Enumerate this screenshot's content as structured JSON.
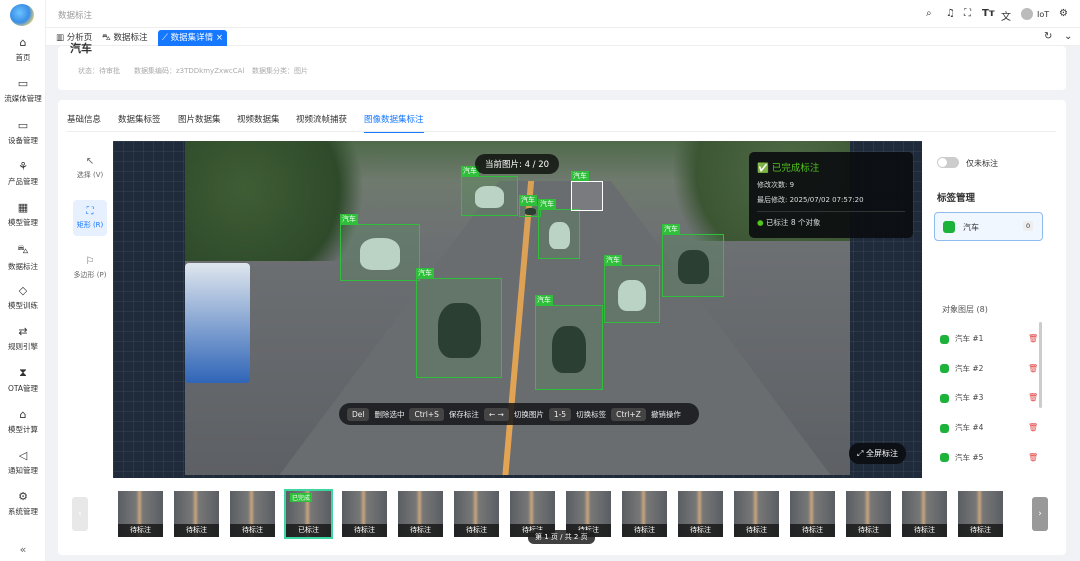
{
  "header": {
    "breadcrumb": "数据标注",
    "user": "IoT"
  },
  "sidebar": {
    "items": [
      {
        "label": "首页",
        "icon": "⌂"
      },
      {
        "label": "流媒体管理",
        "icon": "▭"
      },
      {
        "label": "设备管理",
        "icon": "▭"
      },
      {
        "label": "产品管理",
        "icon": "⚘"
      },
      {
        "label": "模型管理",
        "icon": "▦"
      },
      {
        "label": "数据标注",
        "icon": "⛍"
      },
      {
        "label": "模型训练",
        "icon": "◇"
      },
      {
        "label": "规则引擎",
        "icon": "⇄"
      },
      {
        "label": "OTA管理",
        "icon": "⧗"
      },
      {
        "label": "模型计算",
        "icon": "⌂"
      },
      {
        "label": "通知管理",
        "icon": "◁"
      },
      {
        "label": "系统管理",
        "icon": "⚙"
      }
    ],
    "collapse": "«"
  },
  "tabs": [
    {
      "label": "分析页"
    },
    {
      "label": "数据标注"
    },
    {
      "label": "数据集详情",
      "close": "×"
    }
  ],
  "dataset": {
    "title": "汽车",
    "status": "状态：待审批",
    "code": "数据集编码：z3TDDkmyZxwcCAl",
    "category": "数据集分类：图片"
  },
  "page_tabs": [
    "基础信息",
    "数据集标签",
    "图片数据集",
    "视频数据集",
    "视频流帧捕获",
    "图像数据集标注"
  ],
  "tools": [
    {
      "label": "选择 (V)",
      "icon": "↖"
    },
    {
      "label": "矩形 (R)",
      "icon": "⛶"
    },
    {
      "label": "多边形 (P)",
      "icon": "⚐"
    }
  ],
  "canvas": {
    "current": "当前图片: 4 / 20",
    "box_label": "汽车",
    "fullscreen": "全屏标注"
  },
  "info": {
    "title": "✅ 已完成标注",
    "edits": "修改次数: 9",
    "last": "最后修改: 2025/07/02 07:57:20",
    "count": "已标注 8 个对象"
  },
  "hotkeys": [
    {
      "key": "Del",
      "label": "删除选中"
    },
    {
      "key": "Ctrl+S",
      "label": "保存标注"
    },
    {
      "key": "← →",
      "label": "切换图片"
    },
    {
      "key": "1-5",
      "label": "切换标签"
    },
    {
      "key": "Ctrl+Z",
      "label": "撤销操作"
    }
  ],
  "right": {
    "only_unlabeled": "仅未标注",
    "only_unlabeled_on": false,
    "label_mgmt": "标签管理",
    "label": {
      "name": "汽车",
      "count": "0",
      "color": "#1db33a"
    },
    "layers_title": "对象图层 (8)",
    "layers": [
      "汽车 #1",
      "汽车 #2",
      "汽车 #3",
      "汽车 #4",
      "汽车 #5"
    ]
  },
  "thumbs": [
    "待标注",
    "待标注",
    "待标注",
    "已标注",
    "待标注",
    "待标注",
    "待标注",
    "待标注",
    "待标注",
    "待标注",
    "待标注",
    "待标注",
    "待标注",
    "待标注",
    "待标注",
    "待标注"
  ],
  "thumb_done_tag": "已完成",
  "pager": "第 1 页 / 共 2 页",
  "colors": {
    "accent": "#1677ff",
    "box": "#2fbf3a"
  }
}
